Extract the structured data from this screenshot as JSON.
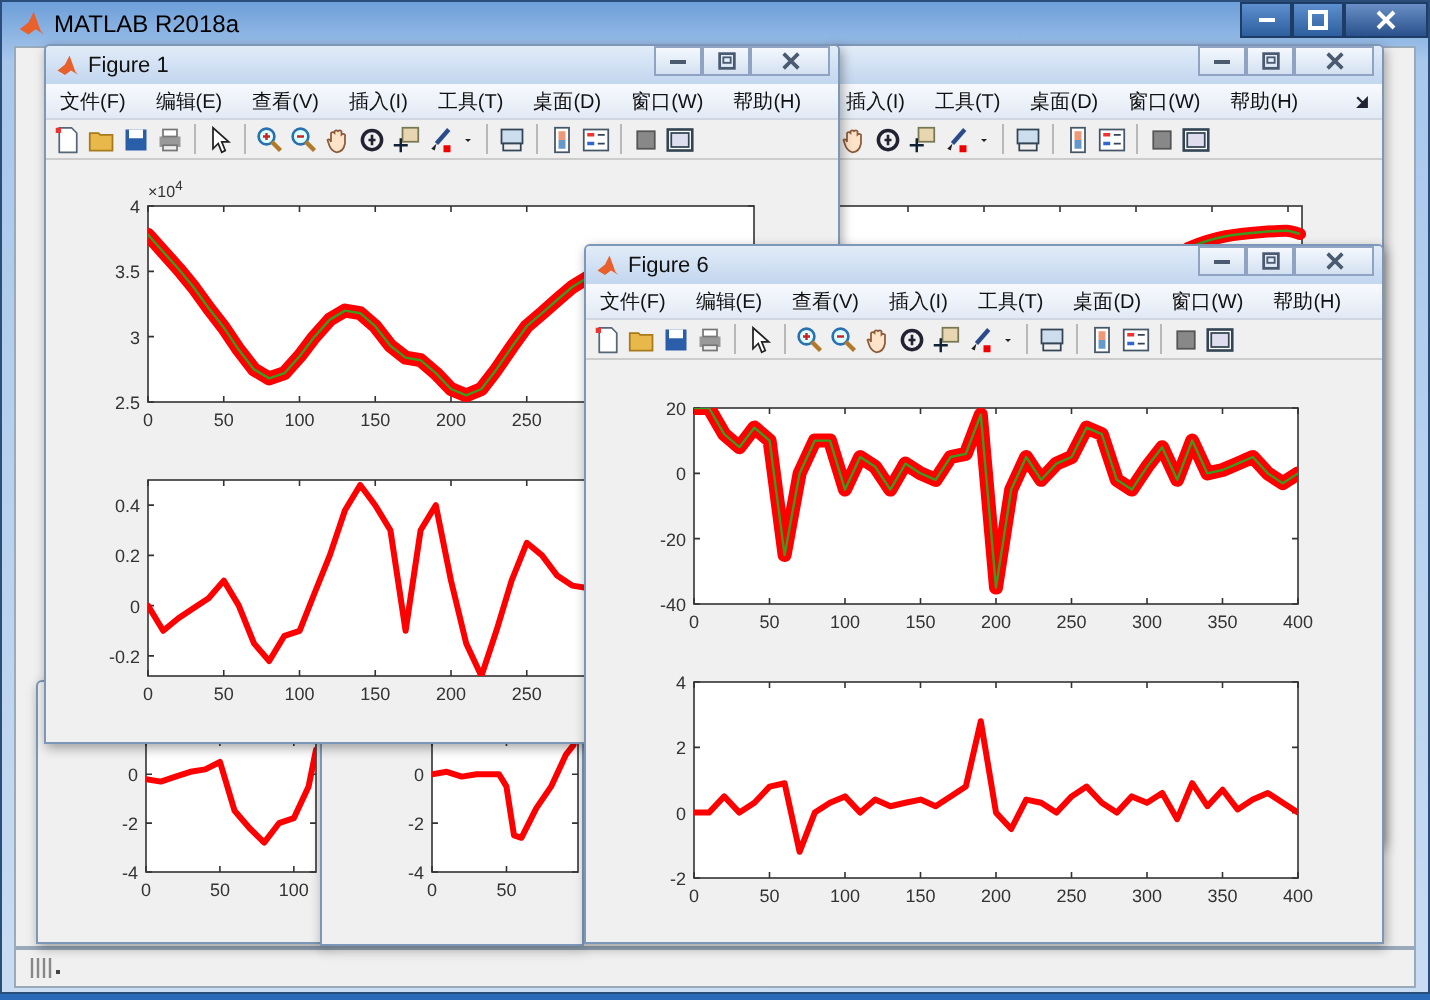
{
  "main_window": {
    "title": "MATLAB R2018a"
  },
  "figures": [
    {
      "menu": [
        "插入(I)",
        "工具(T)",
        "桌面(D)",
        "窗口(W)",
        "帮助(H)"
      ],
      "plots": [
        {
          "kind": "fragment"
        }
      ]
    },
    {
      "plots": [
        {
          "kind": "chart",
          "chart_data": {
            "type": "line",
            "x": [
              0,
              10,
              20,
              30,
              40,
              50,
              60,
              70,
              80,
              90,
              100,
              110,
              115
            ],
            "series": [
              {
                "color": "#ff0000",
                "values": [
                  -0.2,
                  -0.3,
                  -0.1,
                  0.1,
                  0.2,
                  0.5,
                  -1.5,
                  -2.2,
                  -2.8,
                  -2.0,
                  -1.8,
                  -0.5,
                  1.0
                ]
              }
            ],
            "xlim": [
              0,
              115
            ],
            "ylim": [
              -4,
              1.4
            ],
            "xticks": [
              0,
              50,
              100
            ],
            "yticks": [
              -4,
              -2,
              0
            ]
          }
        }
      ]
    },
    {
      "plots": [
        {
          "kind": "chart",
          "chart_data": {
            "type": "line",
            "x": [
              0,
              10,
              20,
              30,
              40,
              45,
              50,
              55,
              60,
              70,
              80,
              90,
              95
            ],
            "series": [
              {
                "color": "#ff0000",
                "values": [
                  0,
                  0.1,
                  -0.1,
                  0,
                  0,
                  0,
                  -0.5,
                  -2.5,
                  -2.6,
                  -1.4,
                  -0.5,
                  0.8,
                  1.2
                ]
              }
            ],
            "xlim": [
              0,
              98
            ],
            "ylim": [
              -4,
              1.4
            ],
            "xticks": [
              0,
              50
            ],
            "yticks": [
              -4,
              -2,
              0
            ]
          }
        }
      ]
    },
    {
      "title": "Figure 1",
      "menu": [
        "文件(F)",
        "编辑(E)",
        "查看(V)",
        "插入(I)",
        "工具(T)",
        "桌面(D)",
        "窗口(W)",
        "帮助(H)"
      ],
      "plots": [
        {
          "kind": "chart",
          "exponent_label": "×10$^{4}$",
          "chart_data": {
            "type": "line",
            "x": [
              0,
              10,
              20,
              30,
              40,
              50,
              60,
              70,
              80,
              90,
              100,
              110,
              120,
              130,
              140,
              150,
              160,
              170,
              180,
              190,
              200,
              210,
              220,
              230,
              240,
              250,
              260,
              270,
              280,
              290
            ],
            "series": [
              {
                "color": "#ff0000",
                "values": [
                  3.78,
                  3.65,
                  3.52,
                  3.38,
                  3.22,
                  3.07,
                  2.9,
                  2.75,
                  2.68,
                  2.72,
                  2.85,
                  3.0,
                  3.13,
                  3.2,
                  3.18,
                  3.08,
                  2.93,
                  2.84,
                  2.82,
                  2.72,
                  2.6,
                  2.55,
                  2.6,
                  2.75,
                  2.92,
                  3.08,
                  3.18,
                  3.28,
                  3.38,
                  3.45
                ]
              },
              {
                "color": "#3c9a1e",
                "values": [
                  3.78,
                  3.65,
                  3.52,
                  3.38,
                  3.22,
                  3.07,
                  2.9,
                  2.75,
                  2.68,
                  2.72,
                  2.85,
                  3.0,
                  3.13,
                  3.2,
                  3.18,
                  3.08,
                  2.93,
                  2.84,
                  2.82,
                  2.72,
                  2.6,
                  2.55,
                  2.6,
                  2.75,
                  2.92,
                  3.08,
                  3.18,
                  3.28,
                  3.38,
                  3.45
                ]
              }
            ],
            "xlim": [
              0,
              400
            ],
            "ylim": [
              2.5,
              4
            ],
            "xticks": [
              0,
              50,
              100,
              150,
              200,
              250
            ],
            "yticks": [
              2.5,
              3,
              3.5,
              4
            ]
          }
        },
        {
          "kind": "chart",
          "chart_data": {
            "type": "line",
            "x": [
              0,
              10,
              20,
              30,
              40,
              50,
              60,
              70,
              80,
              90,
              100,
              110,
              120,
              130,
              140,
              150,
              160,
              170,
              180,
              190,
              200,
              210,
              220,
              230,
              240,
              250,
              260,
              270,
              280,
              290
            ],
            "series": [
              {
                "color": "#ff0000",
                "values": [
                  0,
                  -0.1,
                  -0.05,
                  -0.01,
                  0.03,
                  0.1,
                  0.0,
                  -0.15,
                  -0.22,
                  -0.12,
                  -0.1,
                  0.05,
                  0.2,
                  0.38,
                  0.48,
                  0.4,
                  0.3,
                  -0.1,
                  0.3,
                  0.4,
                  0.1,
                  -0.15,
                  -0.28,
                  -0.1,
                  0.1,
                  0.25,
                  0.2,
                  0.12,
                  0.08,
                  0.07
                ]
              }
            ],
            "xlim": [
              0,
              400
            ],
            "ylim": [
              -0.28,
              0.5
            ],
            "xticks": [
              0,
              50,
              100,
              150,
              200,
              250
            ],
            "yticks": [
              -0.2,
              0,
              0.2,
              0.4
            ]
          }
        }
      ]
    },
    {
      "title": "Figure 6",
      "menu": [
        "文件(F)",
        "编辑(E)",
        "查看(V)",
        "插入(I)",
        "工具(T)",
        "桌面(D)",
        "窗口(W)",
        "帮助(H)"
      ],
      "plots": [
        {
          "kind": "chart",
          "chart_data": {
            "type": "line",
            "x": [
              0,
              10,
              20,
              30,
              40,
              50,
              60,
              70,
              80,
              90,
              100,
              110,
              120,
              130,
              140,
              150,
              160,
              170,
              180,
              190,
              200,
              210,
              220,
              230,
              240,
              250,
              260,
              270,
              280,
              290,
              300,
              310,
              320,
              330,
              340,
              350,
              360,
              370,
              380,
              390,
              400
            ],
            "series": [
              {
                "color": "#ff0000",
                "values": [
                  20,
                  20,
                  12,
                  8,
                  14,
                  10,
                  -25,
                  0,
                  10,
                  10,
                  -5,
                  5,
                  2,
                  -5,
                  3,
                  0,
                  -2,
                  5,
                  6,
                  18,
                  -35,
                  -5,
                  5,
                  -2,
                  3,
                  5,
                  14,
                  12,
                  -2,
                  -5,
                  2,
                  8,
                  -2,
                  10,
                  0,
                  1,
                  3,
                  5,
                  0,
                  -3,
                  0
                ]
              },
              {
                "color": "#3c9a1e",
                "values": [
                  20,
                  20,
                  12,
                  8,
                  14,
                  10,
                  -25,
                  0,
                  10,
                  10,
                  -5,
                  5,
                  2,
                  -5,
                  3,
                  0,
                  -2,
                  5,
                  6,
                  18,
                  -35,
                  -5,
                  5,
                  -2,
                  3,
                  5,
                  14,
                  12,
                  -2,
                  -5,
                  2,
                  8,
                  -2,
                  10,
                  0,
                  1,
                  3,
                  5,
                  0,
                  -3,
                  0
                ]
              }
            ],
            "xlim": [
              0,
              400
            ],
            "ylim": [
              -40,
              20
            ],
            "xticks": [
              0,
              50,
              100,
              150,
              200,
              250,
              300,
              350,
              400
            ],
            "yticks": [
              -40,
              -20,
              0,
              20
            ]
          }
        },
        {
          "kind": "chart",
          "chart_data": {
            "type": "line",
            "x": [
              0,
              10,
              20,
              30,
              40,
              50,
              60,
              70,
              80,
              90,
              100,
              110,
              120,
              130,
              140,
              150,
              160,
              170,
              180,
              190,
              200,
              210,
              220,
              230,
              240,
              250,
              260,
              270,
              280,
              290,
              300,
              310,
              320,
              330,
              340,
              350,
              360,
              370,
              380,
              390,
              400
            ],
            "series": [
              {
                "color": "#ff0000",
                "values": [
                  0,
                  0,
                  0.5,
                  0,
                  0.3,
                  0.8,
                  0.9,
                  -1.2,
                  0,
                  0.3,
                  0.5,
                  0,
                  0.4,
                  0.2,
                  0.3,
                  0.4,
                  0.2,
                  0.5,
                  0.8,
                  2.8,
                  0,
                  -0.5,
                  0.4,
                  0.3,
                  0,
                  0.5,
                  0.8,
                  0.3,
                  0,
                  0.5,
                  0.3,
                  0.6,
                  -0.2,
                  0.9,
                  0.2,
                  0.7,
                  0.1,
                  0.4,
                  0.6,
                  0.3,
                  0
                ]
              }
            ],
            "xlim": [
              0,
              400
            ],
            "ylim": [
              -2,
              4
            ],
            "xticks": [
              0,
              50,
              100,
              150,
              200,
              250,
              300,
              350,
              400
            ],
            "yticks": [
              -2,
              0,
              2,
              4
            ]
          }
        }
      ]
    }
  ]
}
